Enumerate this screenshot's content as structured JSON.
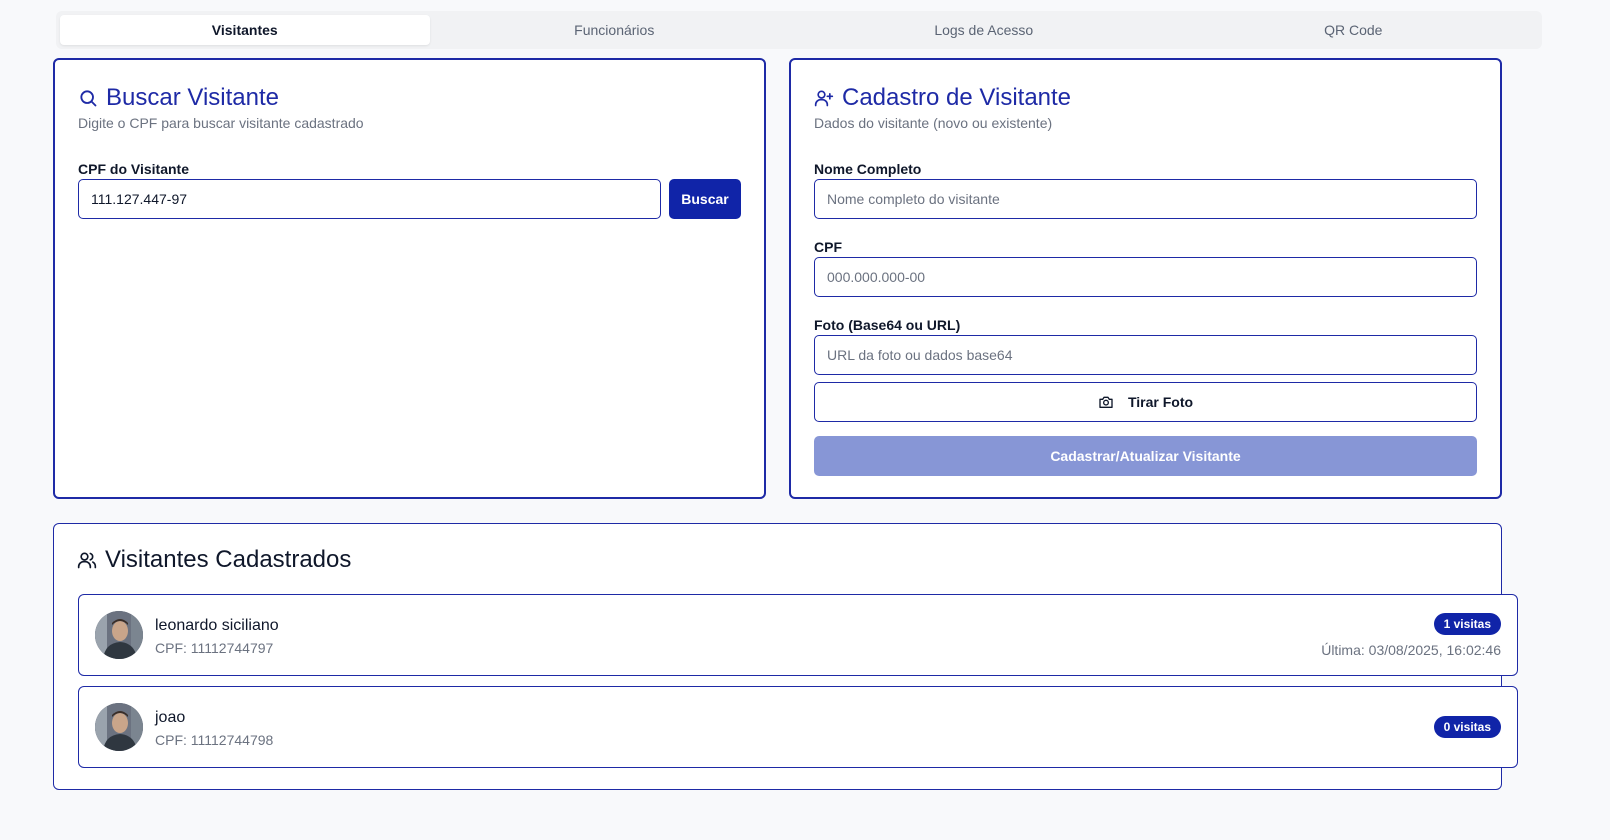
{
  "tabs": [
    {
      "label": "Visitantes",
      "active": true
    },
    {
      "label": "Funcionários",
      "active": false
    },
    {
      "label": "Logs de Acesso",
      "active": false
    },
    {
      "label": "QR Code",
      "active": false
    }
  ],
  "search": {
    "title": "Buscar Visitante",
    "subtitle": "Digite o CPF para buscar visitante cadastrado",
    "cpf_label": "CPF do Visitante",
    "cpf_value": "111.127.447-97",
    "button": "Buscar"
  },
  "register": {
    "title": "Cadastro de Visitante",
    "subtitle": "Dados do visitante (novo ou existente)",
    "name_label": "Nome Completo",
    "name_placeholder": "Nome completo do visitante",
    "cpf_label": "CPF",
    "cpf_placeholder": "000.000.000-00",
    "photo_label": "Foto (Base64 ou URL)",
    "photo_placeholder": "URL da foto ou dados base64",
    "take_photo": "Tirar Foto",
    "submit": "Cadastrar/Atualizar Visitante"
  },
  "visitors": {
    "title": "Visitantes Cadastrados",
    "items": [
      {
        "name": "leonardo siciliano",
        "cpf": "CPF: 11112744797",
        "badge": "1 visitas",
        "last": "Última: 03/08/2025, 16:02:46"
      },
      {
        "name": "joao",
        "cpf": "CPF: 11112744798",
        "badge": "0 visitas",
        "last": ""
      }
    ]
  },
  "colors": {
    "primary": "#1024a8",
    "border": "#1e2aa6",
    "disabled": "#8796d6"
  }
}
